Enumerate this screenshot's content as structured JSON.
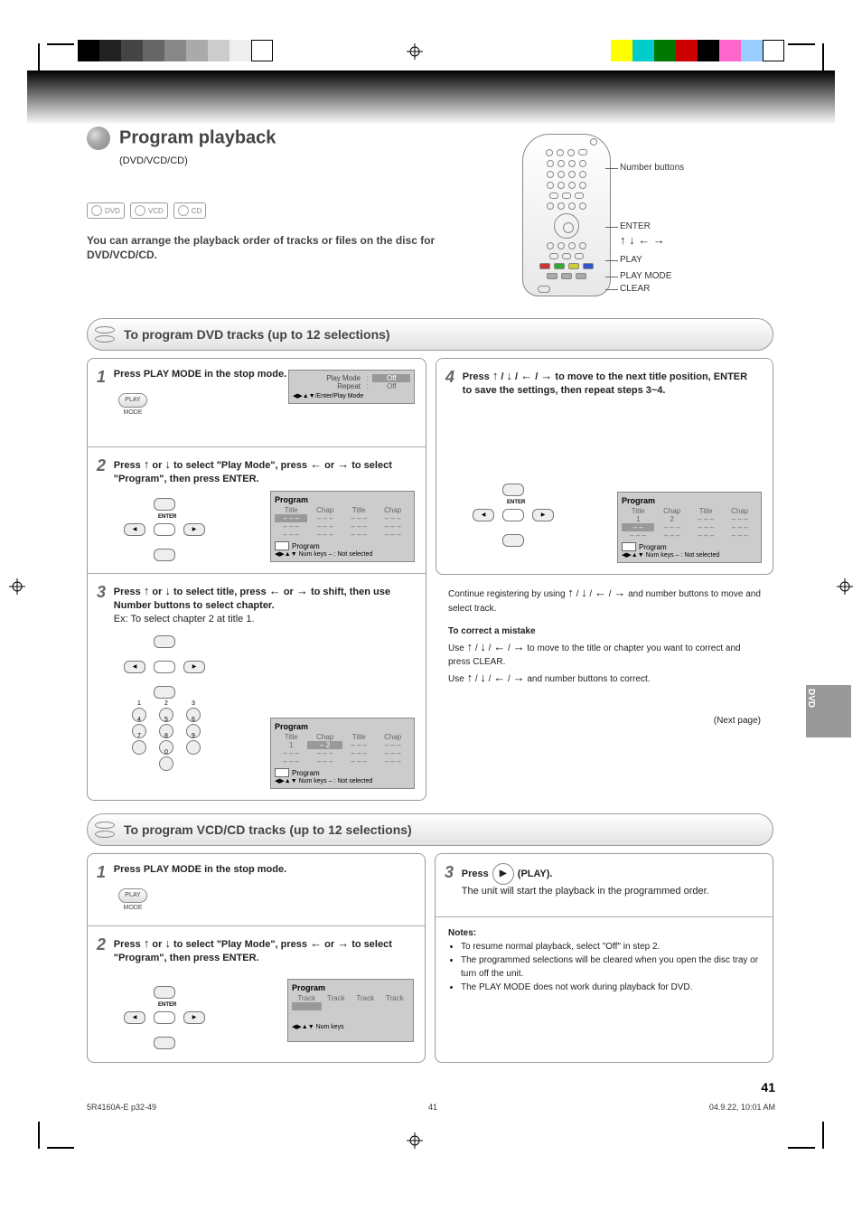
{
  "header": {
    "title": "Program playback",
    "subtitle": "(DVD/VCD/CD)"
  },
  "disc_labels": [
    "DVD",
    "VCD",
    "CD"
  ],
  "blurb": "You can arrange the playback order of tracks or files on the disc for DVD/VCD/CD.",
  "remote_callouts": {
    "num": "Number buttons",
    "arrows": "ENTER",
    "enter": "        /    /    /",
    "play": "PLAY",
    "mode": "PLAY MODE",
    "clear": "CLEAR"
  },
  "sectionA": {
    "title": "To program DVD tracks (up to 12 selections)",
    "steps": [
      {
        "n": "1",
        "text": "Press PLAY MODE in the stop mode.",
        "osd": {
          "rows": [
            [
              "Play Mode",
              ":",
              "Off"
            ],
            [
              "Repeat",
              ":",
              "Off"
            ]
          ],
          "footer": "◀▶▲▼/Enter/Play Mode"
        }
      },
      {
        "n": "2",
        "text": "Press   or   to select \"Play Mode\", press   or   to select \"Program\", then press ENTER.",
        "osd": {
          "title": "Program",
          "cols": [
            "Title",
            "Chap",
            "Title",
            "Chap"
          ],
          "cells": [
            [
              "– – –",
              "– – –",
              "– – –",
              "– – –"
            ],
            [
              "– – –",
              "– – –",
              "– – –",
              "– – –"
            ],
            [
              "– – –",
              "– – –",
              "– – –",
              "– – –"
            ]
          ],
          "footer": "◀▶▲▼ Num keys    – : Not selected"
        }
      },
      {
        "n": "3",
        "text_a": "Press   or   to select title, press   or   to shift, then use Number buttons to select chapter.",
        "text_b": "Ex: To select chapter 2 at title 1.",
        "osd": {
          "title": "Program",
          "cols": [
            "Title",
            "Chap",
            "Title",
            "Chap"
          ],
          "cells": [
            [
              "1",
              "– –",
              "– – –",
              "– – –"
            ],
            [
              "– – –",
              "– – –",
              "– – –",
              "– – –"
            ],
            [
              "– – –",
              "– – –",
              "– – –",
              "– – –"
            ]
          ],
          "hl": "– 2",
          "footer": "◀▶▲▼ Num keys    – : Not selected"
        }
      },
      {
        "n": "4",
        "text": "Press   /   /   /   to move to the next title position, ENTER to save the settings, then repeat steps 3~4.",
        "osd": {
          "title": "Program",
          "cols": [
            "Title",
            "Chap",
            "Title",
            "Chap"
          ],
          "cells": [
            [
              "1",
              "2",
              "– – –",
              "– – –"
            ],
            [
              "– – –",
              "– – –",
              "– – –",
              "– – –"
            ],
            [
              "– – –",
              "– – –",
              "– – –",
              "– – –"
            ]
          ],
          "hl": "– –",
          "footer": "◀▶▲▼ Num keys    – : Not selected"
        },
        "tail": {
          "a": "Continue registering by using   /   /   /   and number buttons to move and select track.",
          "b": "To correct a mistake",
          "c": "Use   /   /   /   to move to the title or chapter you want to correct and press CLEAR.",
          "d": "Use   /   /   /   and number buttons to correct.",
          "hint": "(Next page)"
        }
      }
    ]
  },
  "sectionB": {
    "title": "To program VCD/CD tracks (up to 12 selections)",
    "steps": [
      {
        "n": "1",
        "text": "Press PLAY MODE in the stop mode."
      },
      {
        "n": "2",
        "text": "Press   or   to select \"Play Mode\", press   or   to select \"Program\", then press ENTER.",
        "osd": {
          "title": "Program",
          "cols": [
            "Track",
            "Track",
            "Track",
            "Track"
          ],
          "footer": "◀▶▲▼ Num keys"
        }
      },
      {
        "n": "3",
        "prefix": "Press",
        "suffix": "(PLAY).",
        "text": "The unit will start the playback in the programmed order.",
        "notes_title": "Notes:",
        "notes": [
          "To resume normal playback, select \"Off\" in step 2.",
          "The programmed selections will be cleared when you open the disc tray or turn off the unit.",
          "The PLAY MODE does not work during playback for DVD."
        ]
      }
    ]
  },
  "side_tab": "DVD",
  "page_number": "41",
  "footer": {
    "left": "5R4160A-E p32-49",
    "center": "41",
    "right": "04.9.22, 10:01 AM"
  }
}
